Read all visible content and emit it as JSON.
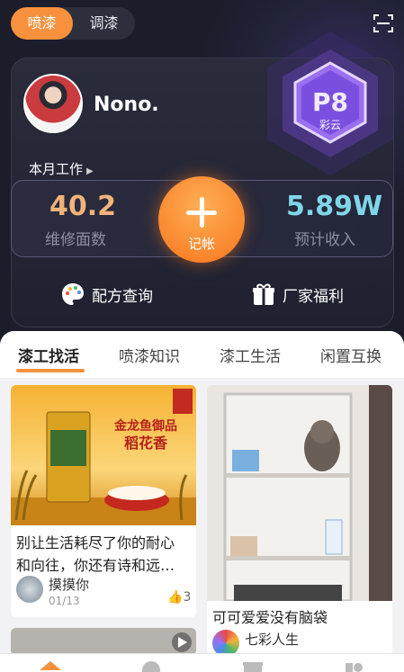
{
  "mode_toggle": {
    "active": "喷漆",
    "inactive": "调漆"
  },
  "profile": {
    "name": "Nono.",
    "level_code": "P8",
    "level_name": "彩云"
  },
  "monthly_work": {
    "label": "本月工作"
  },
  "stats": {
    "repairs_value": "40.2",
    "repairs_label": "维修面数",
    "record_label": "记帐",
    "income_value": "5.89W",
    "income_label": "预计收入"
  },
  "features": {
    "formula": "配方查询",
    "welfare": "厂家福利"
  },
  "tabs": [
    "漆工找活",
    "喷漆知识",
    "漆工生活",
    "闲置互换"
  ],
  "posts": [
    {
      "title_line1": "别让生活耗尽了你的耐心",
      "title_line2": "和向往，你还有诗和远…",
      "author": "摸摸你",
      "date": "01/13",
      "likes": "3"
    },
    {
      "title_line1": "可可爱爱没有脑袋",
      "author": "七彩人生"
    }
  ],
  "ad": {
    "brand": "金龙鱼御品",
    "product": "稻花香"
  },
  "colors": {
    "accent": "#f7913d",
    "stat_left": "#f2b37a",
    "stat_right": "#7fd6e8"
  }
}
